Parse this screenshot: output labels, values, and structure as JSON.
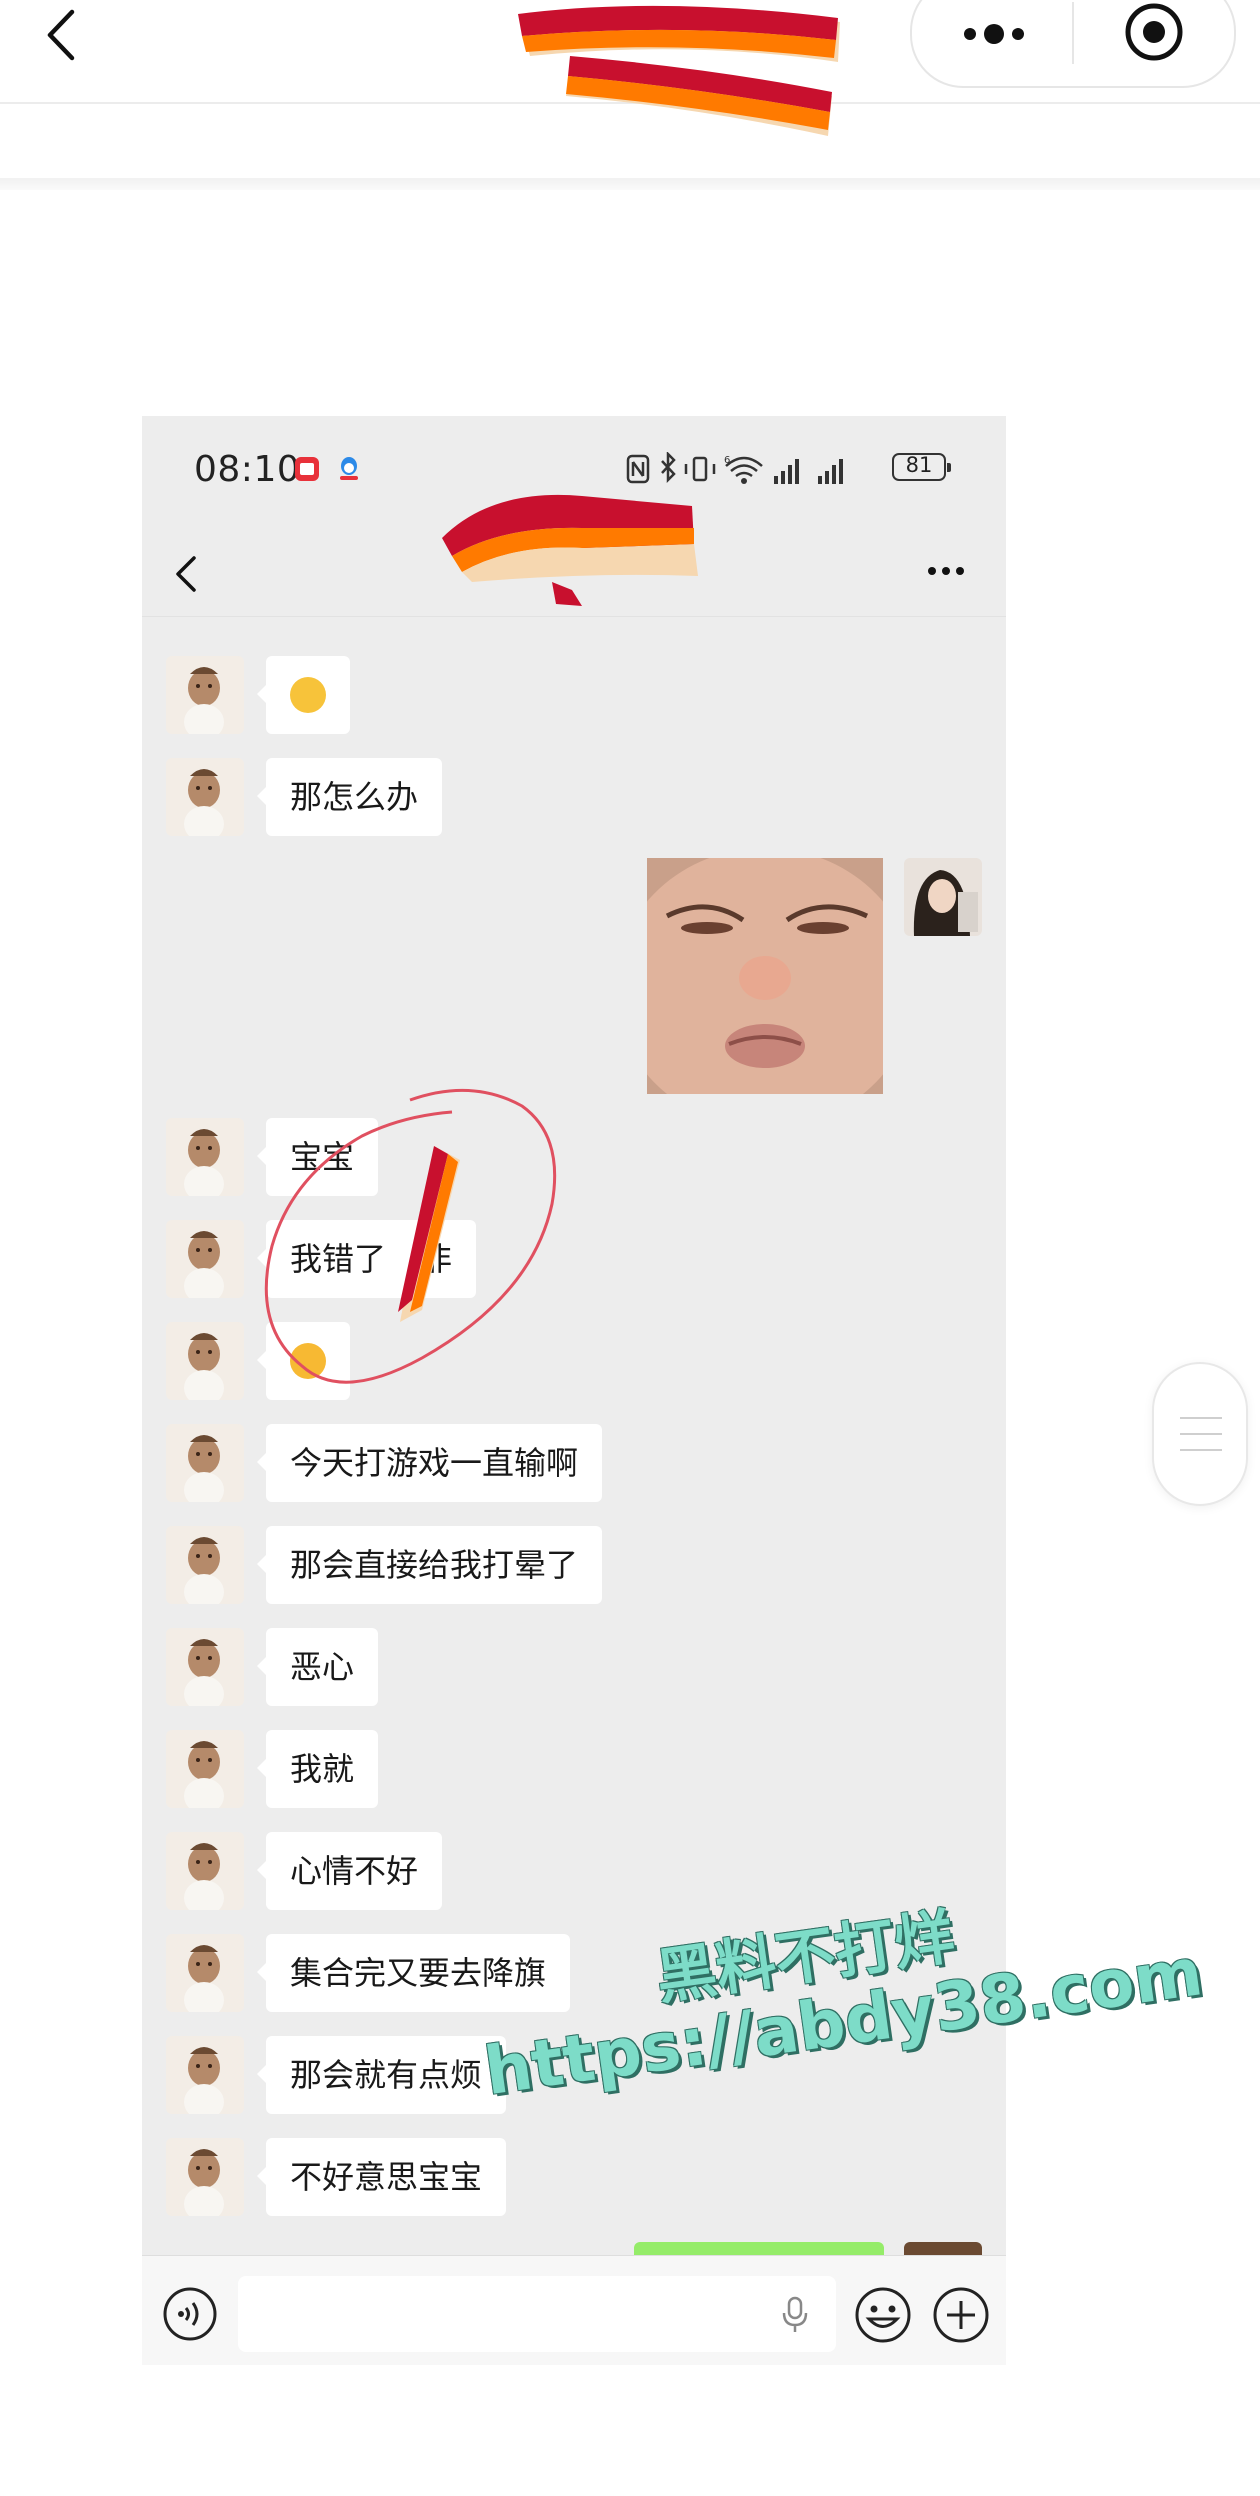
{
  "colors": {
    "page_bg": "#ffffff",
    "chat_bg": "#ededed",
    "bubble_bg": "#ffffff",
    "sent_bubble": "#95ec69",
    "scribble_red": "#c8102e",
    "scribble_orange": "#ff7a00",
    "circle_stroke": "#e05060",
    "watermark": "#7ddcc8"
  },
  "top_bar": {
    "back_icon": "chevron-left-icon",
    "capsule": {
      "more_icon": "more-dots-icon",
      "close_icon": "target-circle-icon"
    }
  },
  "phone": {
    "status_bar": {
      "time": "08:10",
      "battery": "81",
      "icons": [
        "nfc-icon",
        "bluetooth-icon",
        "vibrate-icon",
        "wifi-icon",
        "signal-icon",
        "signal-icon"
      ]
    },
    "nav": {
      "back_icon": "chevron-left-icon",
      "more_icon": "more-dots-icon"
    },
    "messages": [
      {
        "side": "left",
        "type": "emoji",
        "emoji": "🫣"
      },
      {
        "side": "left",
        "type": "text",
        "text": "那怎么办"
      },
      {
        "side": "right",
        "type": "image",
        "image": "baby-pout-sticker"
      },
      {
        "side": "left",
        "type": "text",
        "text": "宝宝"
      },
      {
        "side": "left",
        "type": "text",
        "text": "我错了",
        "suffix": "非"
      },
      {
        "side": "left",
        "type": "emoji",
        "emoji": "🫢"
      },
      {
        "side": "left",
        "type": "text",
        "text": "今天打游戏一直输啊"
      },
      {
        "side": "left",
        "type": "text",
        "text": "那会直接给我打晕了"
      },
      {
        "side": "left",
        "type": "text",
        "text": "恶心"
      },
      {
        "side": "left",
        "type": "text",
        "text": "我就"
      },
      {
        "side": "left",
        "type": "text",
        "text": "心情不好"
      },
      {
        "side": "left",
        "type": "text",
        "text": "集合完又要去降旗"
      },
      {
        "side": "left",
        "type": "text",
        "text": "那会就有点烦"
      },
      {
        "side": "left",
        "type": "text",
        "text": "不好意思宝宝"
      }
    ],
    "input_bar": {
      "voice_icon": "voice-icon",
      "mic_icon": "mic-icon",
      "emoji_icon": "smile-icon",
      "plus_icon": "plus-icon"
    }
  },
  "watermark": {
    "line1": "黑料不打烊",
    "line2": "https://abdy38.com"
  }
}
